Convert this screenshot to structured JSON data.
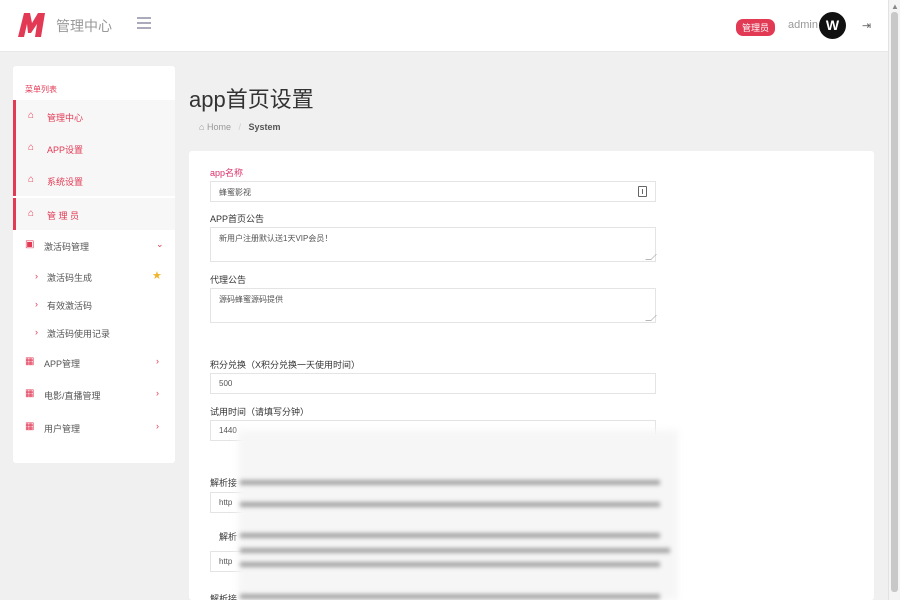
{
  "header": {
    "brand": "管理中心",
    "admin_badge": "管理员",
    "user_name": "admin",
    "avatar_letter": "W"
  },
  "sidebar": {
    "title": "菜单列表",
    "items": [
      {
        "label": "管理中心",
        "icon": "home-icon",
        "active": true
      },
      {
        "label": "APP设置",
        "icon": "home-icon",
        "active": true
      },
      {
        "label": "系统设置",
        "icon": "home-icon",
        "active": true
      },
      {
        "label": "管 理 员",
        "icon": "home-icon",
        "active": true
      },
      {
        "label": "激活码管理",
        "icon": "card-icon",
        "chevron": "down"
      },
      {
        "label": "APP管理",
        "icon": "table-icon",
        "chevron": "right"
      },
      {
        "label": "电影/直播管理",
        "icon": "table-icon",
        "chevron": "right"
      },
      {
        "label": "用户管理",
        "icon": "table-icon",
        "chevron": "right"
      }
    ],
    "subitems": [
      {
        "label": "激活码生成",
        "starred": true
      },
      {
        "label": "有效激活码"
      },
      {
        "label": "激活码使用记录"
      }
    ]
  },
  "page": {
    "title": "app首页设置",
    "breadcrumb_home": "Home",
    "breadcrumb_current": "System"
  },
  "form": {
    "app_name_label": "app名称",
    "app_name_value": "蜂蜜影视",
    "notice_label": "APP首页公告",
    "notice_value": "新用户注册默认送1天VIP会员！",
    "agent_label": "代理公告",
    "agent_value": "源码蜂蜜源码提供",
    "points_label": "积分兑换（X积分兑换一天使用时间）",
    "points_value": "500",
    "trial_label": "试用时间（请填写分钟）",
    "trial_value": "1440",
    "parse1_label": "解析接",
    "parse1_value": "http",
    "parse2_label": "解析",
    "parse2_value": "http",
    "parse3_label": "解析接"
  },
  "colors": {
    "accent": "#e23a55",
    "star": "#f0b429"
  }
}
